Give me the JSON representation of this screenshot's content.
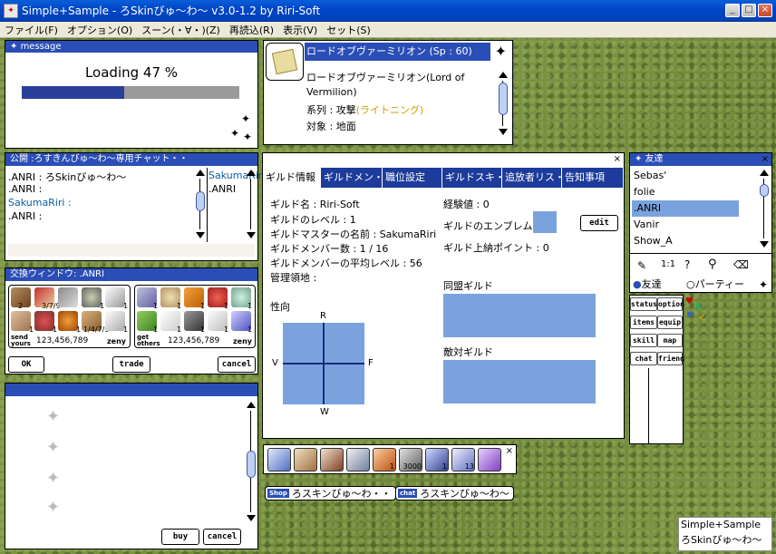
{
  "window": {
    "title": "Simple+Sample - ろSkinびゅ～わ～ v3.0-1.2 by Riri-Soft",
    "minimize": "_",
    "maximize": "□",
    "close": "×"
  },
  "menu": [
    "ファイル(F)",
    "オプション(O)",
    "スーン(・∀・)(Z)",
    "再読込(R)",
    "表示(V)",
    "セット(S)"
  ],
  "message": {
    "title": "message",
    "loading": "Loading 47 %",
    "progress": 0.47
  },
  "skill": {
    "title": "ロードオブヴァーミリオン (Sp : 60)",
    "name1": "ロードオブヴァーミリオン(Lord of",
    "name2": "Vermilion)",
    "type_label": "系列 : 攻撃",
    "type_value": "(ライトニング)",
    "target": "対象 : 地面"
  },
  "chat": {
    "title": "公開 :ろすきんびゅ～わ～専用チャット・・",
    "lines": [
      ".ANRI : ろSkinびゅ～わ～",
      ".ANRI :",
      "SakumaRiri :",
      ".ANRI :"
    ],
    "members": [
      "SakumaRiri",
      ".ANRI"
    ]
  },
  "trade": {
    "title": "交換ウィンドウ: .ANRI",
    "send_label": "send yours",
    "send_amount": "123,456,789",
    "recv_label": "get others",
    "recv_amount": "123,456,789",
    "zeny": "zeny",
    "ok": "OK",
    "trade": "trade",
    "cancel": "cancel",
    "left_counts": [
      "2",
      "3/7/9",
      "1",
      "1",
      "1",
      "1",
      "1",
      "1/4/7/9",
      "1"
    ],
    "right_counts": [
      "1",
      "1",
      "1",
      "1",
      "1",
      "1",
      "1",
      "1",
      "1",
      "1"
    ]
  },
  "shop": {
    "buy": "buy",
    "cancel": "cancel"
  },
  "guild": {
    "tabs": [
      "ギルド情報",
      "ギルドメン・",
      "職位設定",
      "ギルドスキ・",
      "追放者リス・",
      "告知事項"
    ],
    "name": "ギルド名 : Riri-Soft",
    "level": "ギルドのレベル : 1",
    "master": "ギルドマスターの名前 : SakumaRiri",
    "members": "ギルドメンバー数 : 1 / 16",
    "avg": "ギルドメンバーの平均レベル : 56",
    "territory": "管理領地 :",
    "exp": "経験値 : 0",
    "emblem": "ギルドのエンブレム",
    "edit": "edit",
    "points": "ギルド上納ポイント : 0",
    "tendency": "性向",
    "R": "R",
    "V": "V",
    "F": "F",
    "W": "W",
    "allied": "同盟ギルド",
    "hostile": "敵対ギルド"
  },
  "friends": {
    "title": "友達",
    "list": [
      "Sebas'",
      "folie",
      ".ANRI",
      "Vanir",
      "Show_A"
    ],
    "tab_friend": "友達",
    "tab_party": "パーティー"
  },
  "sidebar": {
    "buttons": [
      [
        "status",
        "option"
      ],
      [
        "items",
        "equip"
      ],
      [
        "skill",
        "map"
      ],
      [
        "chat",
        "friend"
      ]
    ]
  },
  "hotkeys": {
    "count1": "1",
    "count2": "3000",
    "count3": "1",
    "count4": "13"
  },
  "bubbles": {
    "shop_tag": "Shop",
    "shop_text": "ろスキンびゅ～わ・・",
    "chat_tag": "chat",
    "chat_text": "ろスキンびゅ～わ～"
  },
  "corner": {
    "line1": "Simple+Sample",
    "line2": "ろSkinびゅ～わ～"
  },
  "colors": {
    "titlebar": "#0046c8",
    "window_title": "#2b4eb6",
    "progress": "#2a3f9a",
    "box": "#7aa3de"
  }
}
